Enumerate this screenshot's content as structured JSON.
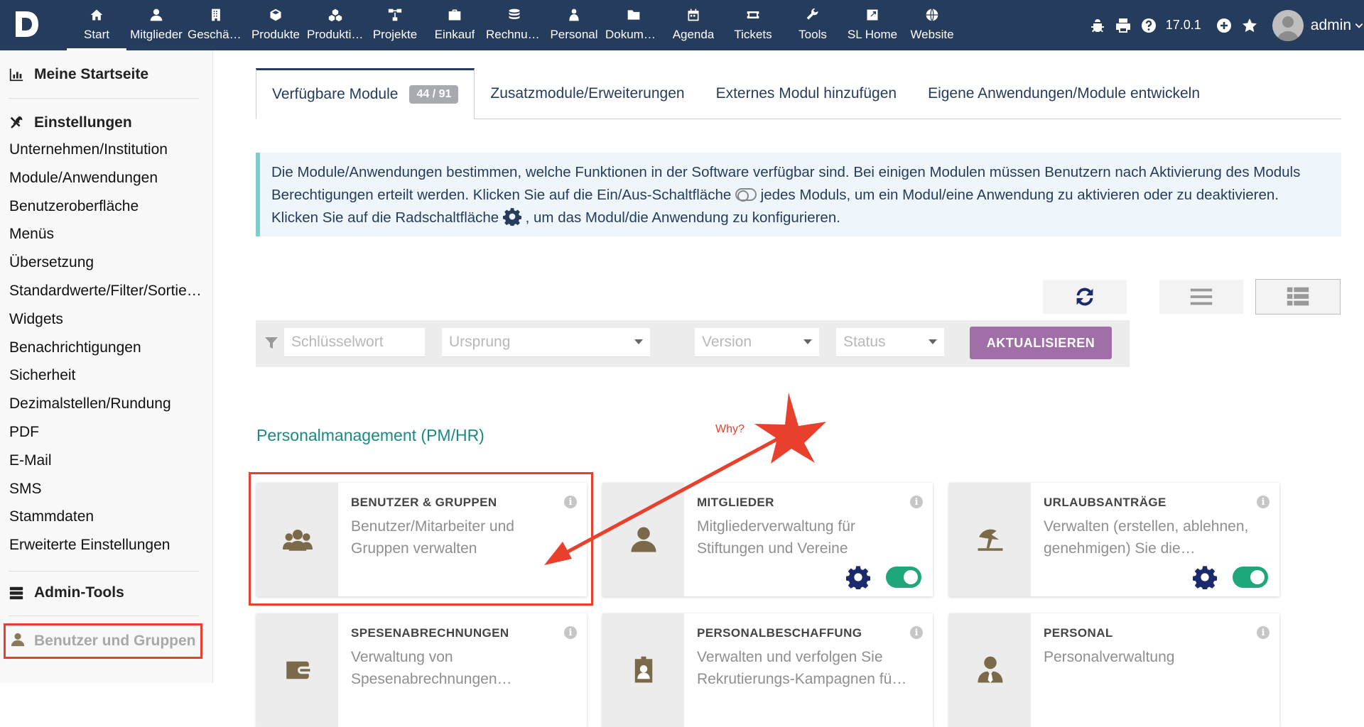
{
  "topbar": {
    "nav": [
      {
        "label": "Start",
        "icon": "home-icon"
      },
      {
        "label": "Mitglieder",
        "icon": "user-icon"
      },
      {
        "label": "Geschäftspartner",
        "icon": "building-icon"
      },
      {
        "label": "Produkte",
        "icon": "cube-icon"
      },
      {
        "label": "Produktion",
        "icon": "cubes-icon"
      },
      {
        "label": "Projekte",
        "icon": "sitemap-icon"
      },
      {
        "label": "Einkauf",
        "icon": "briefcase-icon"
      },
      {
        "label": "Rechnungen",
        "icon": "coins-icon"
      },
      {
        "label": "Personal",
        "icon": "person-icon"
      },
      {
        "label": "Dokumente",
        "icon": "folder-icon"
      },
      {
        "label": "Agenda",
        "icon": "calendar-icon"
      },
      {
        "label": "Tickets",
        "icon": "ticket-icon"
      },
      {
        "label": "Tools",
        "icon": "wrench-icon"
      },
      {
        "label": "SL Home",
        "icon": "external-link-icon"
      },
      {
        "label": "Website",
        "icon": "globe-icon"
      }
    ],
    "version": "17.0.1",
    "username": "admin"
  },
  "sidebar": {
    "home": "Meine Startseite",
    "settings_title": "Einstellungen",
    "items": [
      "Unternehmen/Institution",
      "Module/Anwendungen",
      "Benutzeroberfläche",
      "Menüs",
      "Übersetzung",
      "Standardwerte/Filter/Sortierung",
      "Widgets",
      "Benachrichtigungen",
      "Sicherheit",
      "Dezimalstellen/Rundung",
      "PDF",
      "E-Mail",
      "SMS",
      "Stammdaten",
      "Erweiterte Einstellungen"
    ],
    "admin_tools": "Admin-Tools",
    "bottom_item": "Benutzer und Gruppen"
  },
  "tabs": [
    {
      "label": "Verfügbare Module",
      "badge": "44 / 91"
    },
    {
      "label": "Zusatzmodule/Erweiterungen"
    },
    {
      "label": "Externes Modul hinzufügen"
    },
    {
      "label": "Eigene Anwendungen/Module entwickeln"
    }
  ],
  "info": {
    "part1": "Die Module/Anwendungen bestimmen, welche Funktionen in der Software verfügbar sind. Bei einigen Modulen müssen Benutzern nach Aktivierung des Moduls Berechtigungen erteilt werden. Klicken Sie auf die Ein/Aus-Schaltfläche",
    "part2": "jedes Moduls, um ein Modul/eine Anwendung zu aktivieren oder zu deaktivieren. Klicken Sie auf die Radschaltfläche",
    "part3": ", um das Modul/die Anwendung zu konfigurieren."
  },
  "filters": {
    "keyword_placeholder": "Schlüsselwort",
    "origin_placeholder": "Ursprung",
    "version_placeholder": "Version",
    "status_placeholder": "Status",
    "update_button": "AKTUALISIEREN"
  },
  "section_title": "Personalmanagement (PM/HR)",
  "annotation": "Why?",
  "cards": [
    {
      "title": "BENUTZER & GRUPPEN",
      "desc": "Benutzer/Mitarbeiter und Gruppen verwalten",
      "icon": "users-icon",
      "enabled": false
    },
    {
      "title": "MITGLIEDER",
      "desc": "Mitgliederverwaltung für Stiftungen und Vereine",
      "icon": "user-icon",
      "enabled": true
    },
    {
      "title": "URLAUBSANTRÄGE",
      "desc": "Verwalten (erstellen, ablehnen, genehmigen) Sie die…",
      "icon": "umbrella-beach-icon",
      "enabled": true
    },
    {
      "title": "SPESENABRECHNUNGEN",
      "desc": "Verwaltung von Spesenabrechnungen…",
      "icon": "wallet-icon",
      "enabled": false
    },
    {
      "title": "PERSONALBESCHAFFUNG",
      "desc": "Verwalten und verfolgen Sie Rekrutierungs-Kampagnen fü…",
      "icon": "id-badge-icon",
      "enabled": false
    },
    {
      "title": "PERSONAL",
      "desc": "Personalverwaltung",
      "icon": "user-tie-icon",
      "enabled": false
    }
  ]
}
